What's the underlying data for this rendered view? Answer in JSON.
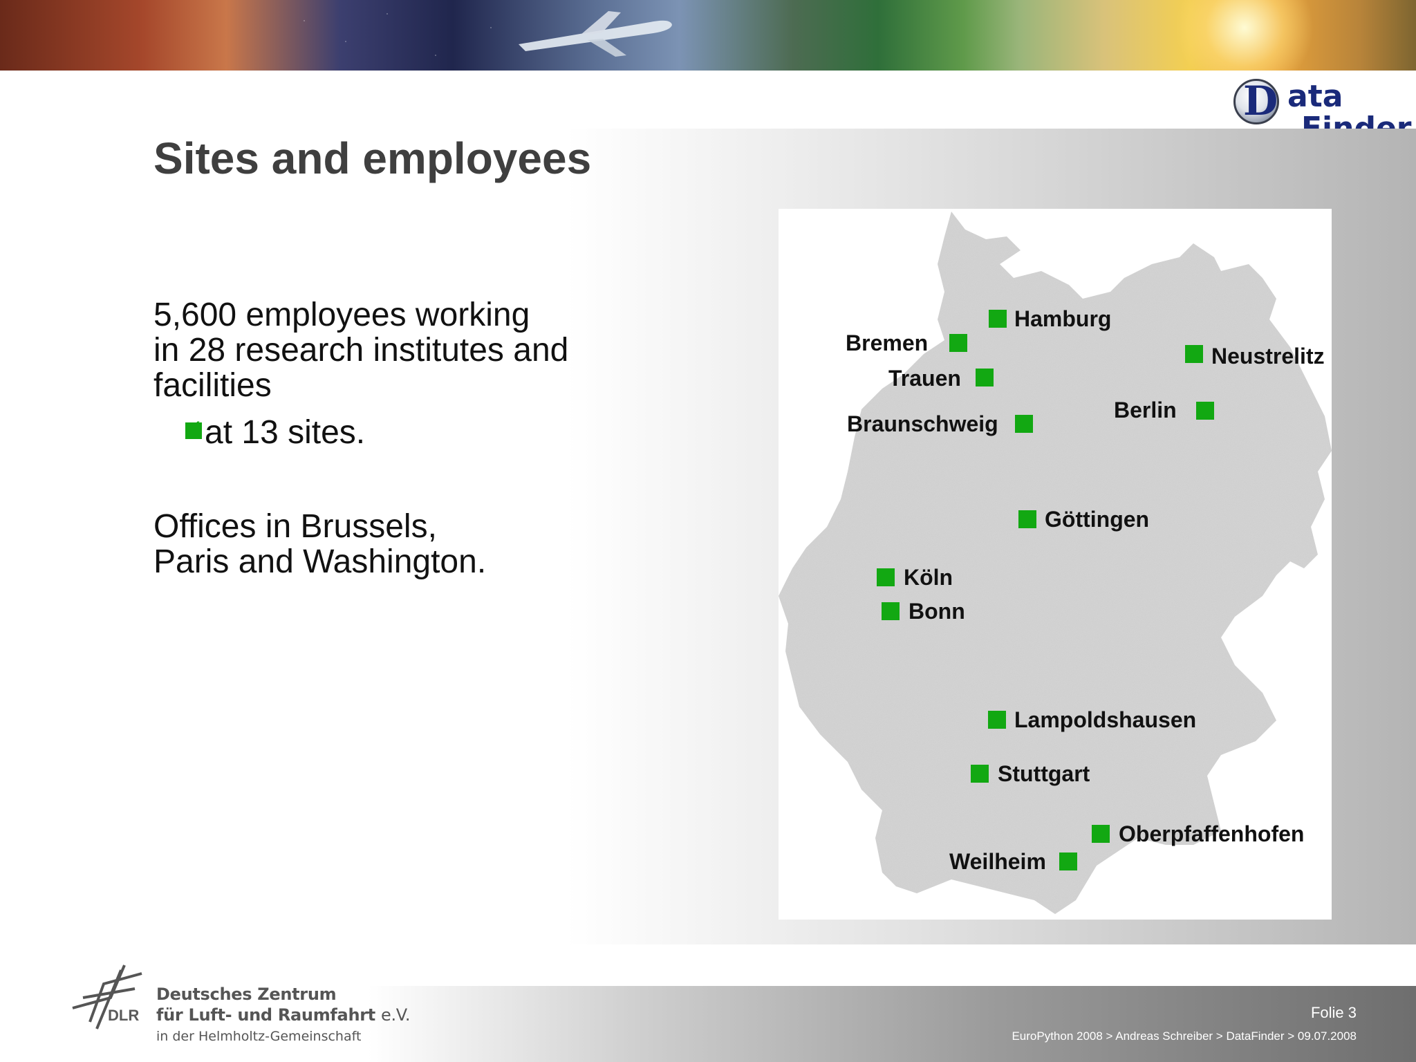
{
  "logo": {
    "d": "D",
    "ata": "ata",
    "finder": "Finder"
  },
  "title": "Sites and employees",
  "body": {
    "para1": [
      "5,600 employees working",
      "in 28 research institutes and",
      "facilities"
    ],
    "bullet": "at 13 sites.",
    "para2": [
      "Offices in Brussels,",
      "Paris and Washington."
    ]
  },
  "map": {
    "cities": [
      {
        "name": "Hamburg"
      },
      {
        "name": "Bremen"
      },
      {
        "name": "Neustrelitz"
      },
      {
        "name": "Trauen"
      },
      {
        "name": "Berlin"
      },
      {
        "name": "Braunschweig"
      },
      {
        "name": "Göttingen"
      },
      {
        "name": "Köln"
      },
      {
        "name": "Bonn"
      },
      {
        "name": "Lampoldshausen"
      },
      {
        "name": "Stuttgart"
      },
      {
        "name": "Oberpfaffenhofen"
      },
      {
        "name": "Weilheim"
      }
    ]
  },
  "colors": {
    "marker": "#12a812",
    "title": "#3f3f3f"
  },
  "footer": {
    "dlr": "DLR",
    "org_line1": "Deutsches Zentrum",
    "org_line2": "für Luft- und Raumfahrt",
    "org_ev": "e.V.",
    "org_line3": "in der Helmholtz-Gemeinschaft",
    "slide_number": "Folie 3",
    "breadcrumb": "EuroPython 2008 > Andreas Schreiber > DataFinder > 09.07.2008"
  }
}
